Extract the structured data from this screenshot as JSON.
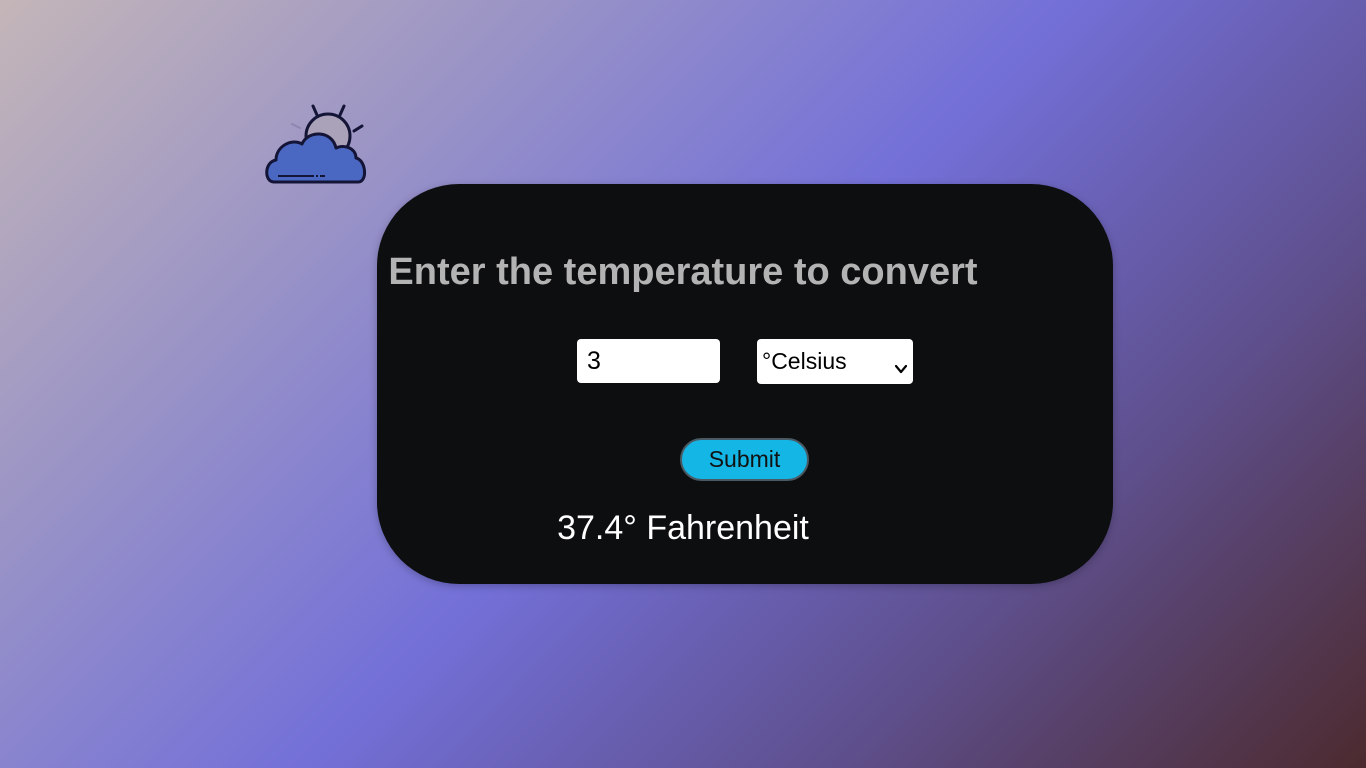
{
  "header": {
    "logo_icon": "cloud-sun-icon"
  },
  "converter": {
    "title": "Enter the temperature to convert",
    "input_value": "3",
    "unit_selected": "°Celsius",
    "submit_label": "Submit",
    "result_text": "37.4° Fahrenheit"
  },
  "colors": {
    "card_background": "#0d0e10",
    "button_accent": "#14b6e6",
    "title_text": "#b3b3b3",
    "result_text": "#ffffff"
  }
}
